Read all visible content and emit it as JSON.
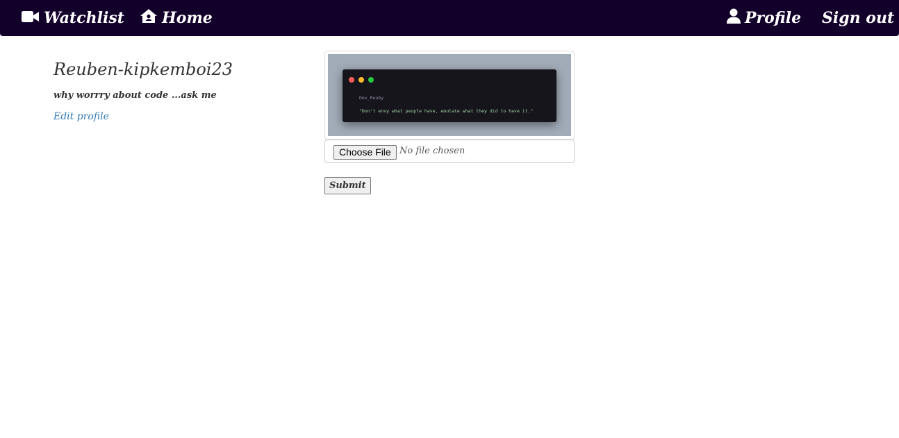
{
  "navbar": {
    "watchlist_label": "Watchlist",
    "watchlist_icon": "video-camera-icon",
    "home_label": "Home",
    "home_icon": "house-icon",
    "profile_label": "Profile",
    "profile_icon": "user-icon",
    "signout_label": "Sign out",
    "background_color": "#12002b"
  },
  "profile": {
    "username": "Reuben-kipkemboi23",
    "bio": "why worrry about code ...ask me",
    "edit_link": "Edit profile"
  },
  "profile_image": {
    "code_title": "Dev_Reuby",
    "code_quote": "\"Don't envy what people have, emulate what they did to have it.\""
  },
  "upload": {
    "choose_file_label": "Choose File",
    "no_file_text": "No file chosen",
    "submit_label": "Submit"
  },
  "colors": {
    "link": "#337ab7",
    "text": "#333333"
  }
}
